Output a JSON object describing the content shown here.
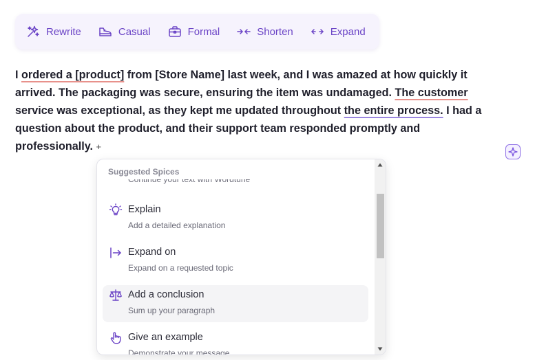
{
  "toolbar": {
    "buttons": [
      {
        "label": "Rewrite",
        "icon": "sparkles-icon"
      },
      {
        "label": "Casual",
        "icon": "shoe-icon"
      },
      {
        "label": "Formal",
        "icon": "briefcase-icon"
      },
      {
        "label": "Shorten",
        "icon": "arrows-in-icon"
      },
      {
        "label": "Expand",
        "icon": "arrows-out-icon"
      }
    ]
  },
  "paragraph": {
    "parts": [
      "I ",
      "ordered a [product]",
      " from [Store Name] last week, and I was amazed at how quickly it arrived. The packaging was secure, ensuring the item was undamaged. ",
      "The customer",
      " service was exceptional, as they kept me updated throughout ",
      "the entire process.",
      " I had a question about the product, and their support team responded promptly and professionally.",
      "+"
    ]
  },
  "dropdown": {
    "header": "Suggested Spices",
    "cut_off_text": "Continue your text with Wordtune",
    "items": [
      {
        "title": "Explain",
        "description": "Add a detailed explanation",
        "icon": "lightbulb-icon"
      },
      {
        "title": "Expand on",
        "description": "Expand on a requested topic",
        "icon": "arrow-right-bar-icon"
      },
      {
        "title": "Add a conclusion",
        "description": "Sum up your paragraph",
        "icon": "scale-icon"
      },
      {
        "title": "Give an example",
        "description": "Demonstrate your message",
        "icon": "pointing-hand-icon"
      }
    ]
  },
  "colors": {
    "accent": "#6b44c6",
    "toolbar_bg": "#f6f3fd",
    "underline_red": "#e8918b",
    "underline_purple": "#9b86e0",
    "hover_bg": "#f4f4f6"
  }
}
